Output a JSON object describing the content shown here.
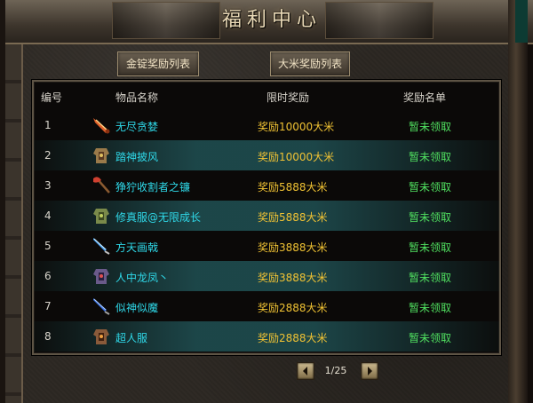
{
  "window": {
    "title": "福利中心"
  },
  "tabs": [
    {
      "label": "金锭奖励列表"
    },
    {
      "label": "大米奖励列表"
    }
  ],
  "table": {
    "headers": [
      "编号",
      "物品名称",
      "限时奖励",
      "奖励名单"
    ],
    "rows": [
      {
        "num": "1",
        "icon": "flame-blade-icon",
        "name": "无尽贪婪",
        "reward": "奖励10000大米",
        "status": "暂未领取"
      },
      {
        "num": "2",
        "icon": "armor-icon",
        "name": "踏神披风",
        "reward": "奖励10000大米",
        "status": "暂未领取"
      },
      {
        "num": "3",
        "icon": "axe-icon",
        "name": "狰狞收割者之镰",
        "reward": "奖励5888大米",
        "status": "暂未领取"
      },
      {
        "num": "4",
        "icon": "armor-icon",
        "name": "修真服@无限成长",
        "reward": "奖励5888大米",
        "status": "暂未领取"
      },
      {
        "num": "5",
        "icon": "blue-sword-icon",
        "name": "方天画戟",
        "reward": "奖励3888大米",
        "status": "暂未领取"
      },
      {
        "num": "6",
        "icon": "armor-icon",
        "name": "人中龙凤丶",
        "reward": "奖励3888大米",
        "status": "暂未领取"
      },
      {
        "num": "7",
        "icon": "blue-sword-icon",
        "name": "似神似魔",
        "reward": "奖励2888大米",
        "status": "暂未领取"
      },
      {
        "num": "8",
        "icon": "armor-icon",
        "name": "超人服",
        "reward": "奖励2888大米",
        "status": "暂未领取"
      }
    ]
  },
  "pager": {
    "text": "1/25"
  },
  "colors": {
    "item_name": "#2fd8e8",
    "reward": "#f0c233",
    "status": "#50e060",
    "title": "#e9d9b6"
  }
}
